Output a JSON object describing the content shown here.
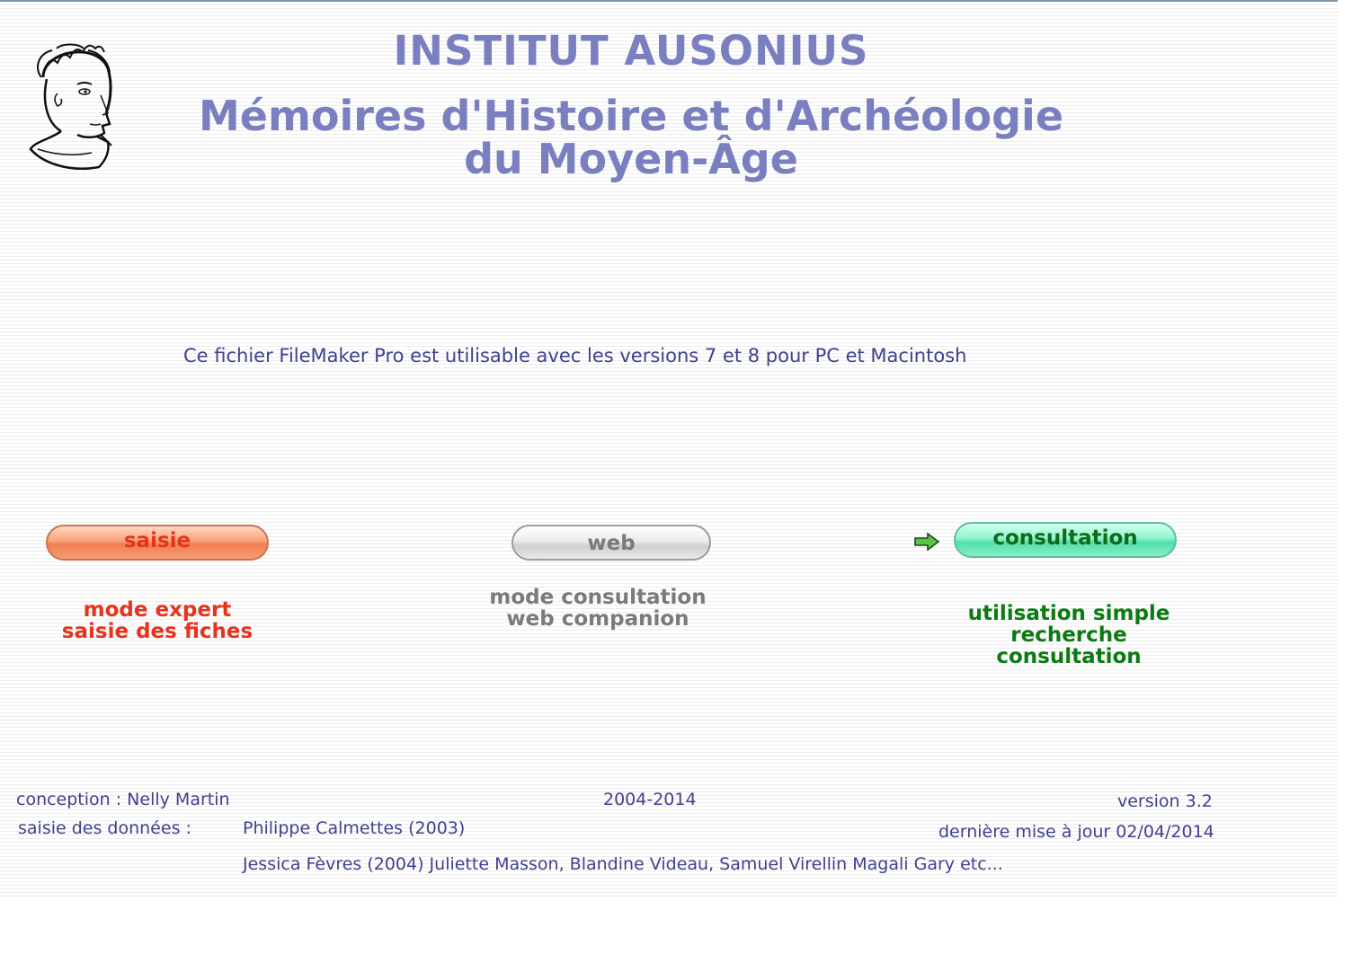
{
  "header": {
    "institute": "INSTITUT AUSONIUS",
    "title_line1": "Mémoires d'Histoire et d'Archéologie",
    "title_line2": "du Moyen-Âge"
  },
  "info_text": "Ce fichier FileMaker Pro est utilisable avec les versions 7 et 8 pour PC et Macintosh",
  "buttons": {
    "saisie": {
      "label": "saisie",
      "desc_line1": "mode expert",
      "desc_line2": "saisie des fiches"
    },
    "web": {
      "label": "web",
      "desc_line1": "mode consultation",
      "desc_line2": "web companion"
    },
    "consultation": {
      "label": "consultation",
      "desc_line1": "utilisation simple",
      "desc_line2": "recherche",
      "desc_line3": "consultation"
    }
  },
  "footer": {
    "conception": "conception : Nelly Martin",
    "years": "2004-2014",
    "version": "version 3.2",
    "saisie_label": "saisie des données :",
    "saisie_names1": "Philippe Calmettes (2003)",
    "last_update": "dernière mise à jour 02/04/2014",
    "saisie_names2": "Jessica Fèvres (2004) Juliette Masson, Blandine Videau, Samuel Virellin Magali Gary etc..."
  },
  "icons": {
    "logo": "roman-head-logo",
    "arrow": "green-arrow-icon"
  },
  "colors": {
    "title": "#7a7fbf",
    "text": "#3f4190",
    "saisie": "#e8331c",
    "web": "#7a7a7a",
    "consultation": "#0c7a12"
  }
}
